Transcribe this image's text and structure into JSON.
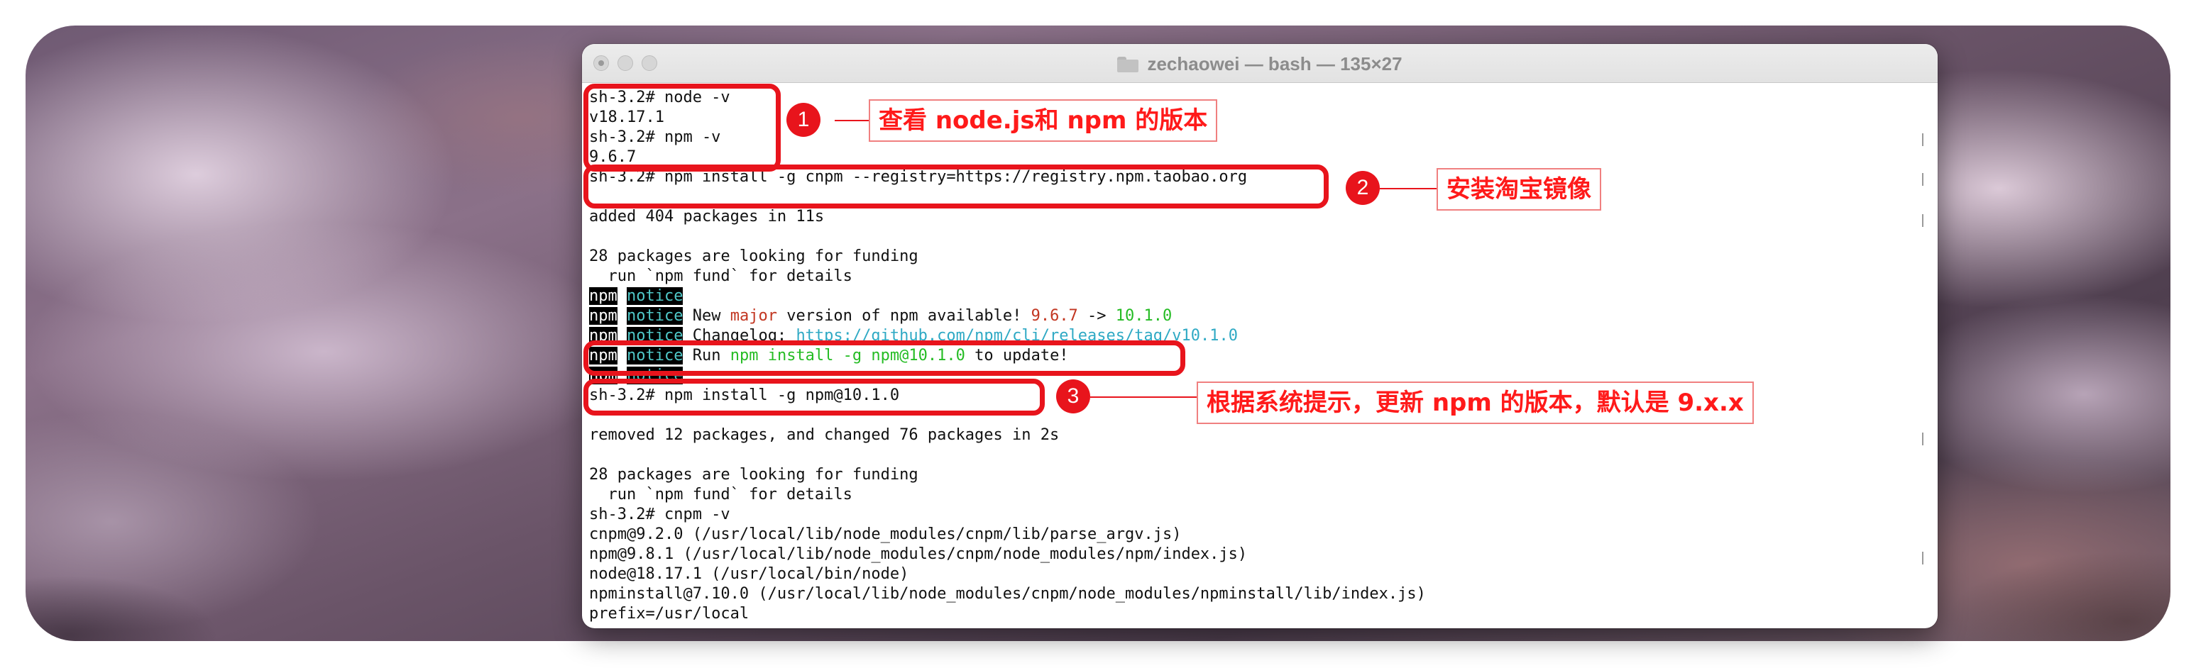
{
  "window": {
    "title": "zechaowei — bash — 135×27"
  },
  "terminal": {
    "lines": {
      "l01": "sh-3.2# node -v",
      "l02": "v18.17.1",
      "l03": "sh-3.2# npm -v",
      "l04": "9.6.7",
      "l05": "sh-3.2# npm install -g cnpm --registry=https://registry.npm.taobao.org",
      "l06": "",
      "l07": "added 404 packages in 11s",
      "l08": "",
      "l09": "28 packages are looking for funding",
      "l10": "  run `npm fund` for details",
      "l11": {
        "npm": "npm",
        "notice": "notice",
        "text": ""
      },
      "l12": {
        "npm": "npm",
        "notice": "notice",
        "pre": " New ",
        "major": "major",
        "mid": " version of npm available! ",
        "old": "9.6.7",
        "arrow": " -> ",
        "new": "10.1.0"
      },
      "l13": {
        "npm": "npm",
        "notice": "notice",
        "pre": " Changelog: ",
        "link": "https://github.com/npm/cli/releases/tag/v10.1.0"
      },
      "l14": {
        "npm": "npm",
        "notice": "notice",
        "pre": " Run ",
        "cmd": "npm install -g npm@10.1.0",
        "post": " to update!"
      },
      "l15": {
        "npm": "npm",
        "notice": "notice",
        "text": ""
      },
      "l16": "sh-3.2# npm install -g npm@10.1.0",
      "l17": "",
      "l18": "removed 12 packages, and changed 76 packages in 2s",
      "l19": "",
      "l20": "28 packages are looking for funding",
      "l21": "  run `npm fund` for details",
      "l22": "sh-3.2# cnpm -v",
      "l23": "cnpm@9.2.0 (/usr/local/lib/node_modules/cnpm/lib/parse_argv.js)",
      "l24": "npm@9.8.1 (/usr/local/lib/node_modules/cnpm/node_modules/npm/index.js)",
      "l25": "node@18.17.1 (/usr/local/bin/node)",
      "l26": "npminstall@7.10.0 (/usr/local/lib/node_modules/cnpm/node_modules/npminstall/lib/index.js)",
      "l27": "prefix=/usr/local"
    },
    "colors": {
      "major": "#c23621",
      "version_new": "#25bc24",
      "link": "#2fa9c4",
      "notice": "#4fc8c8"
    }
  },
  "annotations": {
    "color": "#e8141c",
    "items": [
      {
        "number": "1",
        "text": "查看 node.js和 npm 的版本"
      },
      {
        "number": "2",
        "text": "安装淘宝镜像"
      },
      {
        "number": "3",
        "text": "根据系统提示，更新 npm 的版本，默认是 9.x.x"
      }
    ]
  }
}
